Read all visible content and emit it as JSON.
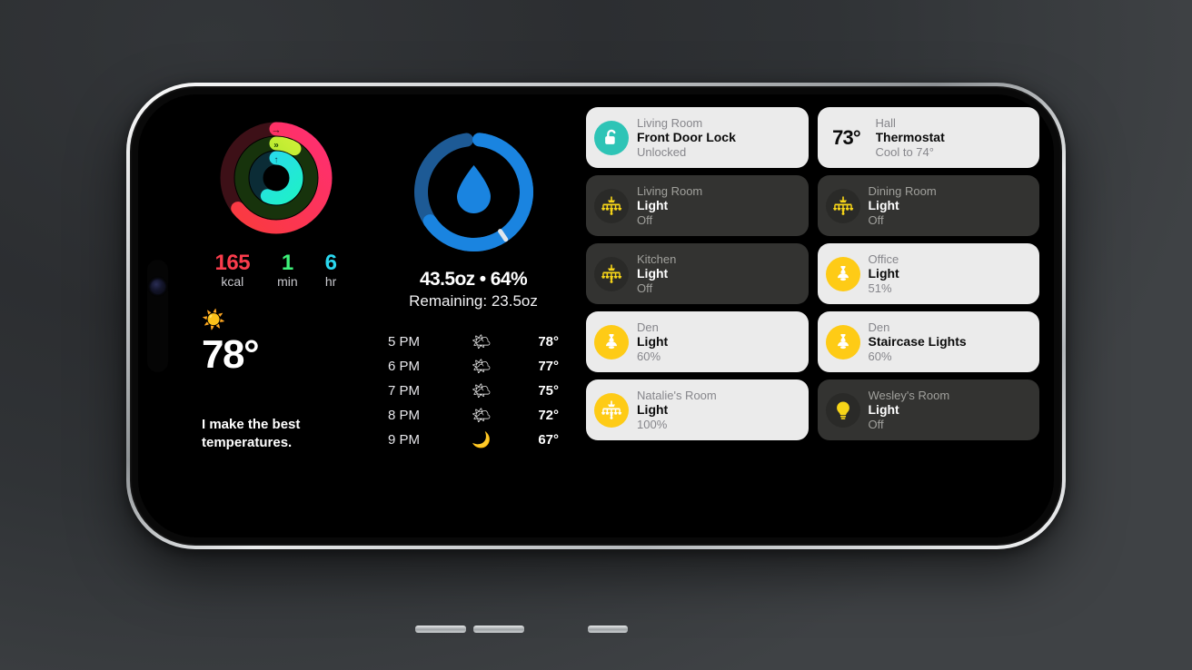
{
  "device": {
    "name": "iPhone",
    "orientation": "landscape"
  },
  "health": {
    "widget_name": "activity-rings",
    "rings": [
      {
        "name": "Move",
        "color": "#fa3c4c",
        "track": "#3d1017",
        "progress_deg": 232,
        "icon": "arrow-right"
      },
      {
        "name": "Exercise",
        "color": "#a8e82f",
        "track": "#17330c",
        "progress_deg": 32,
        "icon": "double-chevron-right"
      },
      {
        "name": "Stand",
        "color": "#2ad8f0",
        "track": "#0b2c36",
        "progress_deg": 205,
        "icon": "arrow-up"
      }
    ],
    "stats": [
      {
        "value": "165",
        "unit": "kcal",
        "color": "#fa3c4c"
      },
      {
        "value": "1",
        "unit": "min",
        "color": "#3ef27a"
      },
      {
        "value": "6",
        "unit": "hr",
        "color": "#2ad8f0"
      }
    ]
  },
  "weather_hero": {
    "icon": "sun-icon",
    "icon_glyph": "☀️",
    "temperature": "78°",
    "quote": "I make the best temperatures."
  },
  "water": {
    "widget_name": "hydration-ring",
    "icon": "water-drop-icon",
    "ring_color": "#1a84e0",
    "track_color": "#1d5a95",
    "percent": 64,
    "amount_label": "43.5oz • 64%",
    "remaining_label": "Remaining: 23.5oz"
  },
  "forecast": {
    "rows": [
      {
        "time": "5 PM",
        "icon": "sun-behind-cloud-icon",
        "glyph": "🌤",
        "temp": "78°"
      },
      {
        "time": "6 PM",
        "icon": "sun-behind-cloud-icon",
        "glyph": "🌤",
        "temp": "77°"
      },
      {
        "time": "7 PM",
        "icon": "sun-behind-cloud-icon",
        "glyph": "🌤",
        "temp": "75°"
      },
      {
        "time": "8 PM",
        "icon": "sun-behind-cloud-icon",
        "glyph": "🌤",
        "temp": "72°"
      },
      {
        "time": "9 PM",
        "icon": "crescent-moon-icon",
        "glyph": "🌙",
        "temp": "67°"
      }
    ]
  },
  "home": {
    "tiles": [
      {
        "room": "Living Room",
        "name": "Front Door Lock",
        "status": "Unlocked",
        "state": "on",
        "icon": "unlocked-padlock-icon",
        "icon_bg": "#2ec4b6",
        "icon_fg": "#ffffff",
        "has_temp": false,
        "temp": ""
      },
      {
        "room": "Hall",
        "name": "Thermostat",
        "status": "Cool to 74°",
        "state": "on",
        "icon": "thermostat-temperature",
        "icon_bg": "",
        "icon_fg": "",
        "has_temp": true,
        "temp": "73°"
      },
      {
        "room": "Living Room",
        "name": "Light",
        "status": "Off",
        "state": "off",
        "icon": "chandelier-icon",
        "icon_bg": "#2a2a28",
        "icon_fg": "#f7d518",
        "has_temp": false,
        "temp": ""
      },
      {
        "room": "Dining Room",
        "name": "Light",
        "status": "Off",
        "state": "off",
        "icon": "chandelier-icon",
        "icon_bg": "#2a2a28",
        "icon_fg": "#f7d518",
        "has_temp": false,
        "temp": ""
      },
      {
        "room": "Kitchen",
        "name": "Light",
        "status": "Off",
        "state": "off",
        "icon": "chandelier-icon",
        "icon_bg": "#2a2a28",
        "icon_fg": "#f7d518",
        "has_temp": false,
        "temp": ""
      },
      {
        "room": "Office",
        "name": "Light",
        "status": "51%",
        "state": "on",
        "icon": "pendant-lamp-icon",
        "icon_bg": "#fecb16",
        "icon_fg": "#ffffff",
        "has_temp": false,
        "temp": ""
      },
      {
        "room": "Den",
        "name": "Light",
        "status": "60%",
        "state": "on",
        "icon": "pendant-lamp-icon",
        "icon_bg": "#fecb16",
        "icon_fg": "#ffffff",
        "has_temp": false,
        "temp": ""
      },
      {
        "room": "Den",
        "name": "Staircase Lights",
        "status": "60%",
        "state": "on",
        "icon": "pendant-lamp-icon",
        "icon_bg": "#fecb16",
        "icon_fg": "#ffffff",
        "has_temp": false,
        "temp": ""
      },
      {
        "room": "Natalie's Room",
        "name": "Light",
        "status": "100%",
        "state": "on",
        "icon": "chandelier-icon",
        "icon_bg": "#fecb16",
        "icon_fg": "#ffffff",
        "has_temp": false,
        "temp": ""
      },
      {
        "room": "Wesley's Room",
        "name": "Light",
        "status": "Off",
        "state": "off",
        "icon": "bulb-icon",
        "icon_bg": "#2a2a28",
        "icon_fg": "#f7d518",
        "has_temp": false,
        "temp": ""
      }
    ]
  }
}
